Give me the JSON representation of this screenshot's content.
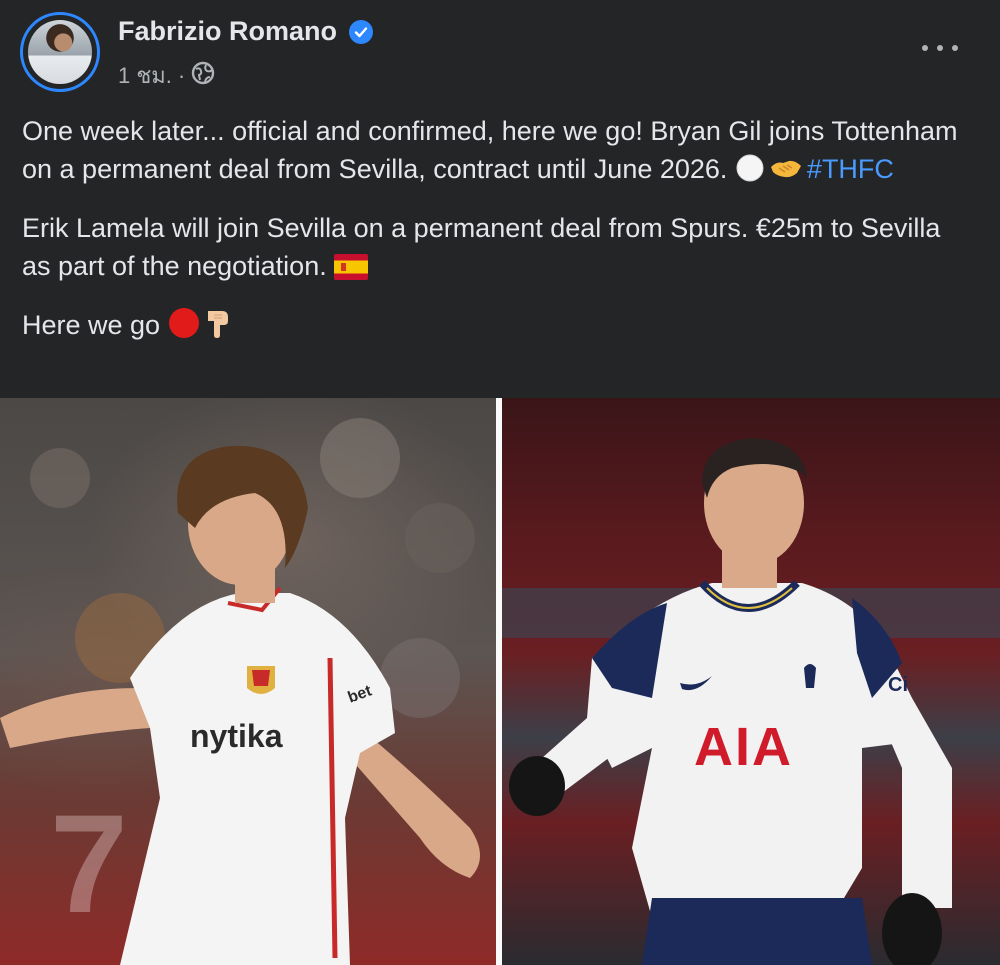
{
  "post": {
    "author": "Fabrizio Romano",
    "time": "1 ชม.",
    "separator": "·",
    "paragraphs": {
      "p1_text": "One week later... official and confirmed, here we go! Bryan Gil joins Tottenham on a permanent deal from Sevilla, contract until June 2026. ",
      "p1_hashtag": "#THFC",
      "p2_text": "Erik Lamela will join Sevilla on a permanent deal from Spurs. €25m to Sevilla as part of the negotiation. ",
      "p3_text": "Here we go "
    }
  },
  "photos": {
    "left_sponsor": "nytika",
    "left_sleeve": "bet",
    "left_bg_text": "7",
    "right_sponsor": "AIA",
    "right_sleeve": "Ci"
  },
  "colors": {
    "background": "#242526",
    "text": "#e4e6eb",
    "secondary": "#b0b3b8",
    "link": "#4a9bff",
    "verified": "#2d88ff"
  },
  "icons": [
    "verified-badge-icon",
    "globe-icon",
    "more-options-icon",
    "white-circle-emoji",
    "handshake-emoji",
    "spain-flag-emoji",
    "red-circle-emoji",
    "pointing-down-emoji"
  ]
}
